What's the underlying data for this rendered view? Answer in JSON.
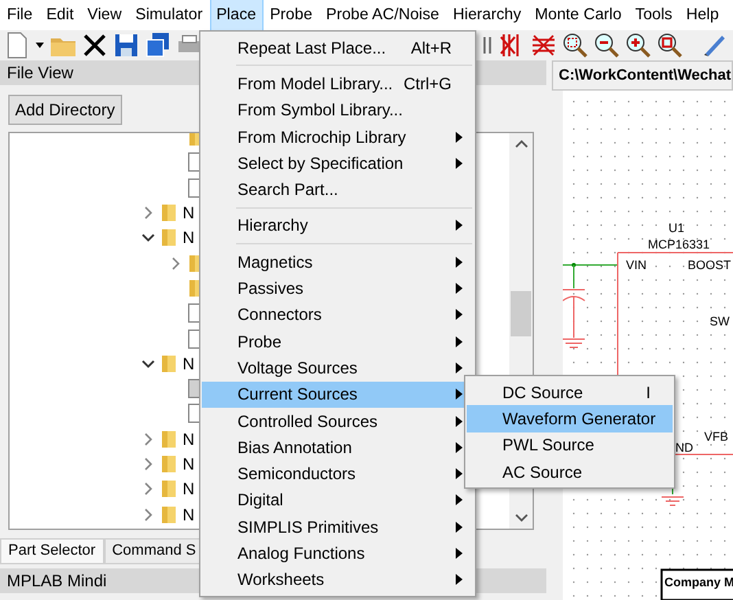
{
  "menubar": [
    {
      "label": "File",
      "selected": false
    },
    {
      "label": "Edit",
      "selected": false
    },
    {
      "label": "View",
      "selected": false
    },
    {
      "label": "Simulator",
      "selected": false
    },
    {
      "label": "Place",
      "selected": true
    },
    {
      "label": "Probe",
      "selected": false
    },
    {
      "label": "Probe AC/Noise",
      "selected": false
    },
    {
      "label": "Hierarchy",
      "selected": false
    },
    {
      "label": "Monte Carlo",
      "selected": false
    },
    {
      "label": "Tools",
      "selected": false
    },
    {
      "label": "Help",
      "selected": false
    }
  ],
  "file_view": {
    "title": "File View",
    "add_button": "Add Directory",
    "tree": {
      "continued": [
        {
          "kind": "folder"
        },
        {
          "kind": "file",
          "selected": false
        },
        {
          "kind": "file",
          "selected": false
        }
      ],
      "items": [
        {
          "kind": "folder",
          "label": "N",
          "expanded": false
        },
        {
          "kind": "folder",
          "label": "N",
          "expanded": true,
          "children": [
            {
              "kind": "folder",
              "expanded": false
            },
            {
              "kind": "folder"
            },
            {
              "kind": "file",
              "selected": false
            },
            {
              "kind": "file",
              "selected": false
            }
          ]
        },
        {
          "kind": "folder",
          "label": "N",
          "expanded": true,
          "children": [
            {
              "kind": "file",
              "selected": true
            },
            {
              "kind": "file",
              "selected": false
            }
          ]
        },
        {
          "kind": "folder",
          "label": "N",
          "expanded": false
        },
        {
          "kind": "folder",
          "label": "N",
          "expanded": false
        },
        {
          "kind": "folder",
          "label": "N",
          "expanded": false
        },
        {
          "kind": "folder",
          "label": "N",
          "expanded": false
        }
      ]
    }
  },
  "bottom_tabs": [
    {
      "label": "Part Selector",
      "selected": true
    },
    {
      "label": "Command S",
      "selected": false
    }
  ],
  "mindi_panel": {
    "title": "MPLAB Mindi"
  },
  "schematic": {
    "title": "C:\\WorkContent\\Wechat",
    "ref": "U1",
    "part": "MCP16331",
    "pins": [
      "VIN",
      "BOOST",
      "SW",
      "VFB",
      "ND"
    ],
    "title_block": "Company M"
  },
  "place_menu": [
    {
      "kind": "item",
      "label": "Repeat Last Place...",
      "shortcut": "Alt+R",
      "submenu": false,
      "selected": false
    },
    {
      "kind": "separator"
    },
    {
      "kind": "item",
      "label": "From Model Library...",
      "shortcut": "Ctrl+G",
      "submenu": false,
      "selected": false
    },
    {
      "kind": "item",
      "label": "From Symbol Library...",
      "submenu": false,
      "selected": false
    },
    {
      "kind": "item",
      "label": "From Microchip Library",
      "submenu": true,
      "selected": false
    },
    {
      "kind": "item",
      "label": "Select by Specification",
      "submenu": true,
      "selected": false
    },
    {
      "kind": "item",
      "label": "Search Part...",
      "submenu": false,
      "selected": false
    },
    {
      "kind": "separator"
    },
    {
      "kind": "item",
      "label": "Hierarchy",
      "submenu": true,
      "selected": false
    },
    {
      "kind": "separator"
    },
    {
      "kind": "item",
      "label": "Magnetics",
      "submenu": true,
      "selected": false
    },
    {
      "kind": "item",
      "label": "Passives",
      "submenu": true,
      "selected": false
    },
    {
      "kind": "item",
      "label": "Connectors",
      "submenu": true,
      "selected": false
    },
    {
      "kind": "item",
      "label": "Probe",
      "submenu": true,
      "selected": false
    },
    {
      "kind": "item",
      "label": "Voltage Sources",
      "submenu": true,
      "selected": false
    },
    {
      "kind": "item",
      "label": "Current Sources",
      "submenu": true,
      "selected": true
    },
    {
      "kind": "item",
      "label": "Controlled Sources",
      "submenu": true,
      "selected": false
    },
    {
      "kind": "item",
      "label": "Bias Annotation",
      "submenu": true,
      "selected": false
    },
    {
      "kind": "item",
      "label": "Semiconductors",
      "submenu": true,
      "selected": false
    },
    {
      "kind": "item",
      "label": "Digital",
      "submenu": true,
      "selected": false
    },
    {
      "kind": "item",
      "label": "SIMPLIS Primitives",
      "submenu": true,
      "selected": false
    },
    {
      "kind": "item",
      "label": "Analog Functions",
      "submenu": true,
      "selected": false
    },
    {
      "kind": "item",
      "label": "Worksheets",
      "submenu": true,
      "selected": false
    }
  ],
  "current_sources_menu": [
    {
      "label": "DC Source",
      "shortcut": "I",
      "selected": false
    },
    {
      "label": "Waveform Generator",
      "selected": true
    },
    {
      "label": "PWL Source",
      "selected": false
    },
    {
      "label": "AC Source",
      "selected": false
    }
  ]
}
